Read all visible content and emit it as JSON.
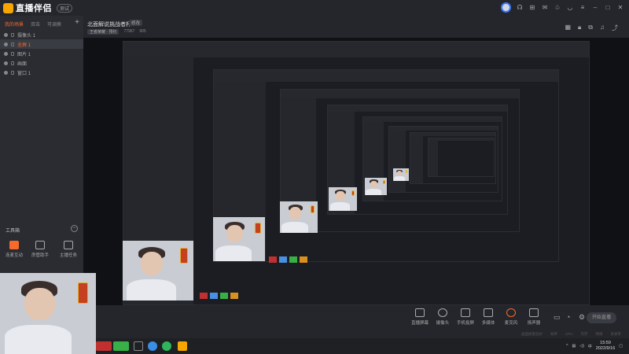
{
  "app": {
    "name": "直播伴侣",
    "version_badge": "测试"
  },
  "titlebar_icons": [
    "user-avatar",
    "headset-icon",
    "gift-icon",
    "mail-icon",
    "shirt-icon",
    "wifi-icon",
    "settings-icon",
    "minimize-icon",
    "maximize-icon",
    "close-icon"
  ],
  "scene_tabs": [
    "我的场景",
    "双击",
    "可调换"
  ],
  "sources": [
    {
      "label": "摄像头 1",
      "selected": false
    },
    {
      "label": "全屏 1",
      "selected": true
    },
    {
      "label": "图片 1",
      "selected": false
    },
    {
      "label": "画面",
      "selected": false
    },
    {
      "label": "窗口 1",
      "selected": false
    }
  ],
  "tools": {
    "title": "工具箱",
    "items": [
      {
        "label": "连麦互动",
        "color": "#f76a2c"
      },
      {
        "label": "房管助手",
        "color": "#aaaaaa"
      },
      {
        "label": "主播任务",
        "color": "#aaaaaa"
      }
    ]
  },
  "room": {
    "title": "北面解说挑战者杯",
    "edit_label": "修改",
    "tag": "王者荣耀 · 预约",
    "fans": "77967",
    "hot": "905"
  },
  "header_icons": [
    "layout-icon",
    "lock-icon",
    "copy-icon",
    "bell-icon",
    "share-icon"
  ],
  "bottom_tools": [
    {
      "label": "直播屏幕"
    },
    {
      "label": "摄像头"
    },
    {
      "label": "手机投屏"
    },
    {
      "label": "多媒体"
    },
    {
      "label": "麦克风"
    },
    {
      "label": "扬声器"
    }
  ],
  "start_button": "开始直播",
  "status_items": [
    "画面质量良好",
    "帧率",
    "CPU",
    "内存",
    "网络",
    "丢帧率"
  ],
  "clock": {
    "time": "15:59",
    "date": "2022/9/16"
  },
  "colors": {
    "accent": "#f76a2c",
    "brand": "#f7a600",
    "bg": "#24262c"
  }
}
